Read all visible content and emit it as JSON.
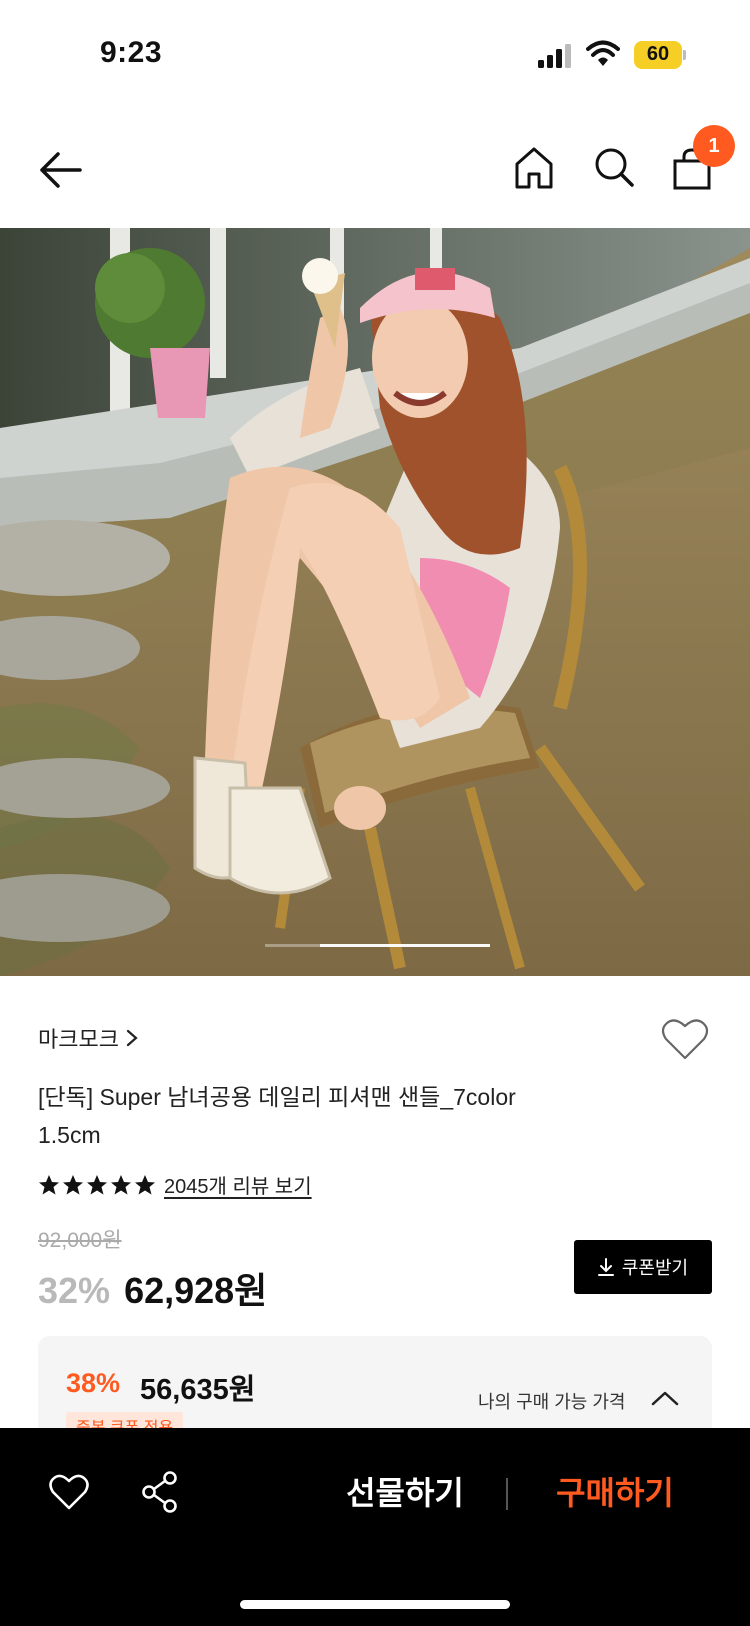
{
  "status_bar": {
    "time": "9:23",
    "battery": "60",
    "battery_color": "#f6cf26"
  },
  "nav": {
    "back_icon": "arrow-left-icon",
    "home_icon": "home-icon",
    "search_icon": "search-icon",
    "bag_icon": "shopping-bag-icon",
    "cart_count": "1",
    "badge_color": "#ff5a1f"
  },
  "hero": {
    "image_index": 1,
    "image_count": 4
  },
  "product": {
    "brand": "마크모크",
    "title_line1": "[단독] Super 남녀공용 데일리 피셔맨 샌들_7color",
    "title_line2": "1.5cm",
    "rating": 5,
    "review_link": "2045개 리뷰 보기",
    "original_price": "92,000원",
    "discount_rate": "32%",
    "sale_price": "62,928원",
    "coupon_button": "쿠폰받기"
  },
  "best_price": {
    "rate": "38%",
    "price": "56,635원",
    "label": "나의 구매 가능 가격",
    "tag": "중복 쿠폰 적용",
    "accent": "#ff5a1f"
  },
  "bottom_bar": {
    "gift_label": "선물하기",
    "buy_label": "구매하기",
    "buy_color": "#ff5a1f"
  }
}
